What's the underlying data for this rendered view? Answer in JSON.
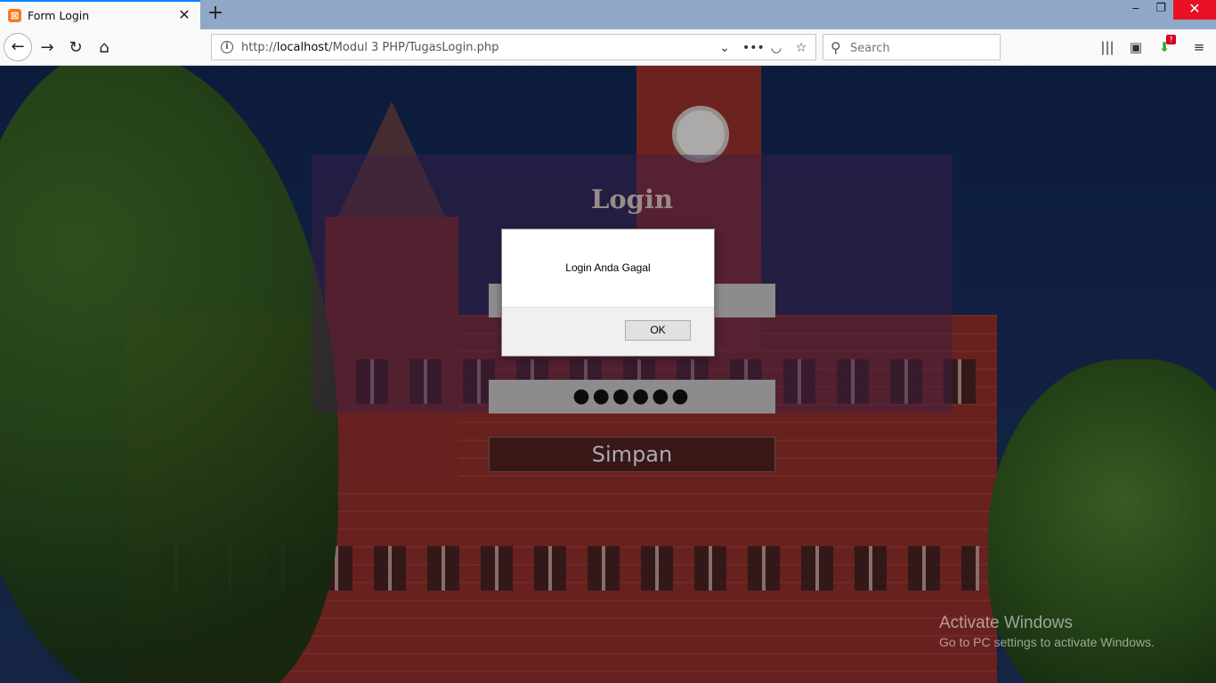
{
  "browser": {
    "tab_title": "Form Login",
    "url_prefix": "http://",
    "url_host": "localhost",
    "url_path": "/Modul 3 PHP/TugasLogin.php",
    "search_placeholder": "Search",
    "new_tab_glyph": "+",
    "tab_close_glyph": "✕",
    "downloads_badge": "?"
  },
  "page": {
    "login_title": "Login",
    "password_dots": "●●●●●●",
    "submit_label": "Simpan"
  },
  "dialog": {
    "message": "Login Anda Gagal",
    "ok_label": "OK"
  },
  "watermark": {
    "line1": "Activate Windows",
    "line2": "Go to PC settings to activate Windows."
  },
  "colors": {
    "accent": "#0a84ff",
    "close_button": "#e81123",
    "favicon": "#fb7a24"
  },
  "icons": [
    "xampp-favicon",
    "close-icon",
    "plus-icon",
    "minimize-icon",
    "restore-icon",
    "window-close-icon",
    "back-icon",
    "forward-icon",
    "reload-icon",
    "home-icon",
    "info-icon",
    "chevron-down-icon",
    "more-icon",
    "pocket-icon",
    "bookmark-star-icon",
    "search-icon",
    "library-icon",
    "sidebar-icon",
    "download-icon",
    "menu-icon"
  ]
}
